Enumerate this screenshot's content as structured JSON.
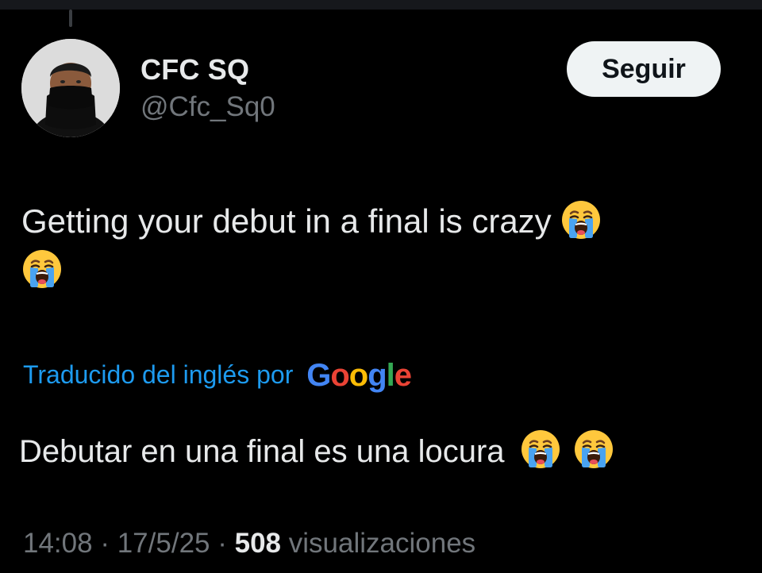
{
  "tweet": {
    "author": {
      "display_name": "CFC SQ",
      "handle": "@Cfc_Sq0"
    },
    "follow_label": "Seguir",
    "text_line1": "Getting your debut in a final is crazy",
    "translation": {
      "label": "Traducido del inglés por",
      "provider": "Google",
      "text": "Debutar en una final es una locura"
    },
    "meta": {
      "time": "14:08",
      "separator1": "·",
      "date": "17/5/25",
      "separator2": "·",
      "views_count": "508",
      "views_label": "visualizaciones"
    },
    "emoji": "loudly-crying-face"
  },
  "colors": {
    "background": "#000000",
    "text": "#e7e9ea",
    "secondary": "#71767b",
    "link": "#1d9bf0",
    "button_bg": "#eff3f4"
  }
}
